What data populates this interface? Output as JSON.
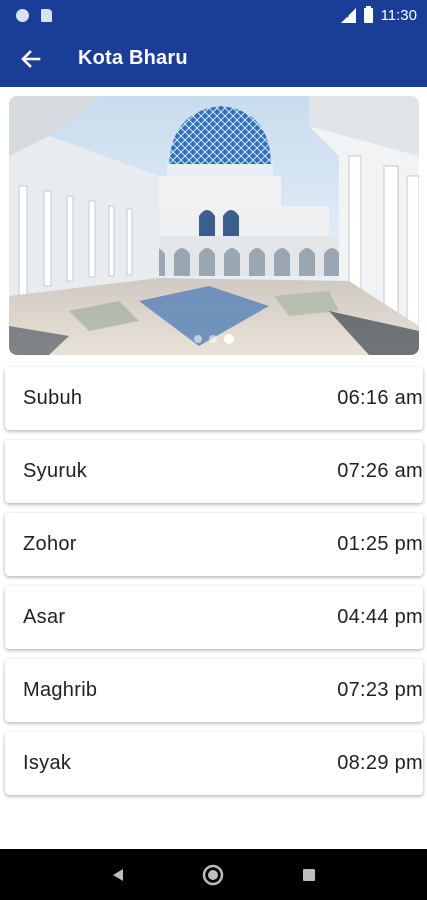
{
  "status_bar": {
    "time": "11:30",
    "icons": [
      "notification-dot-icon",
      "sd-card-icon",
      "signal-icon",
      "battery-icon"
    ]
  },
  "app_bar": {
    "title": "Kota Bharu",
    "back_icon": "arrow-back-icon"
  },
  "carousel": {
    "page_count": 3,
    "active_page": 3
  },
  "prayer_times": [
    {
      "name": "Subuh",
      "time": "06:16 am"
    },
    {
      "name": "Syuruk",
      "time": "07:26 am"
    },
    {
      "name": "Zohor",
      "time": "01:25 pm"
    },
    {
      "name": "Asar",
      "time": "04:44 pm"
    },
    {
      "name": "Maghrib",
      "time": "07:23 pm"
    },
    {
      "name": "Isyak",
      "time": "08:29 pm"
    }
  ],
  "nav_bar": {
    "icons": [
      "back-triangle-icon",
      "home-circle-icon",
      "recents-square-icon"
    ]
  },
  "colors": {
    "primary": "#1a3d97",
    "dome_blue": "#2f6fc0"
  }
}
